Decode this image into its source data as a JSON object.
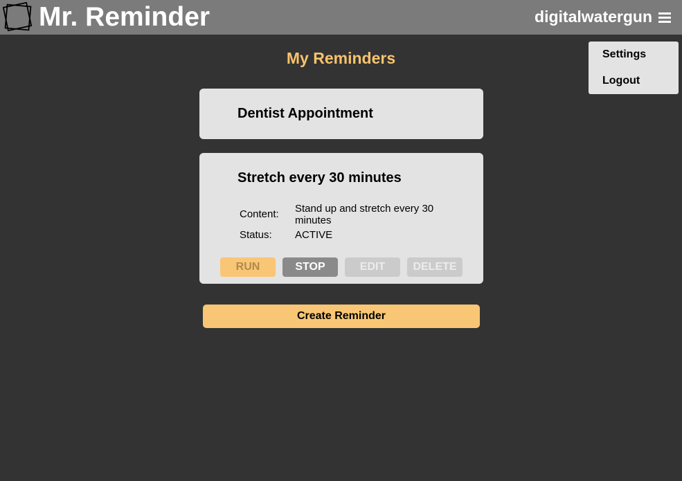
{
  "header": {
    "app_title": "Mr. Reminder",
    "username": "digitalwatergun",
    "logo_icon": "stacked-squares-logo",
    "menu_icon": "hamburger-menu-icon",
    "background": "#7b7b7b"
  },
  "dropdown": {
    "items": [
      {
        "label": "Settings"
      },
      {
        "label": "Logout"
      }
    ]
  },
  "main": {
    "title": "My Reminders",
    "title_color": "#f8c36d"
  },
  "reminders": [
    {
      "title": "Dentist Appointment"
    },
    {
      "title": "Stretch every 30 minutes",
      "content_label": "Content:",
      "content_value": "Stand up and stretch every 30 minutes",
      "status_label": "Status:",
      "status_value": "ACTIVE",
      "buttons": {
        "run": "RUN",
        "stop": "STOP",
        "edit": "EDIT",
        "delete": "DELETE"
      }
    }
  ],
  "create_button": "Create Reminder",
  "colors": {
    "background": "#333333",
    "card": "#e3e3e3",
    "accent": "#f8c675"
  }
}
